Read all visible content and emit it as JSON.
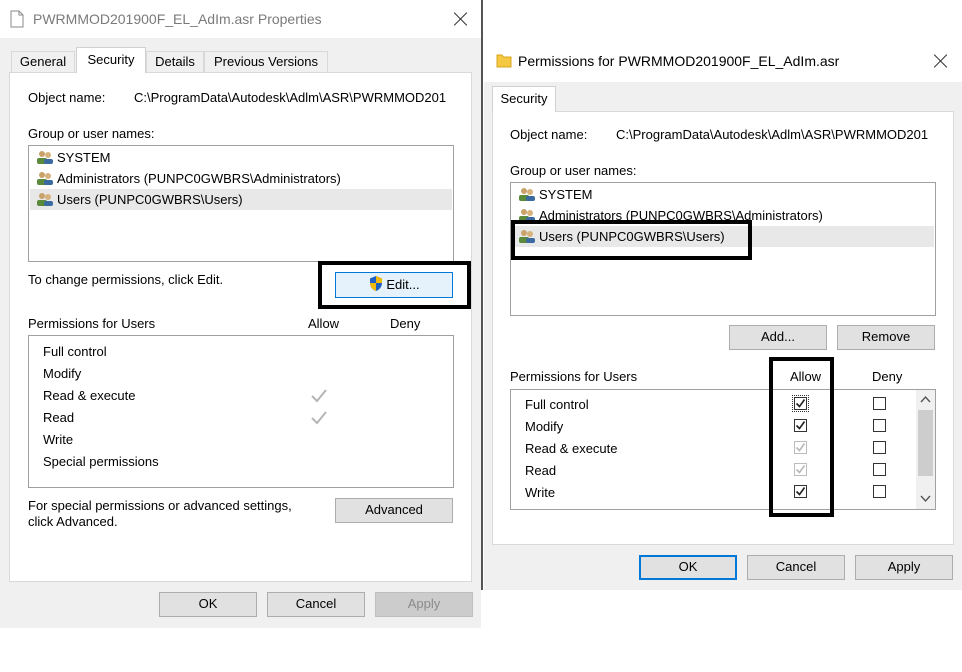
{
  "colors": {
    "highlight_box": "#000000",
    "accent": "#0078d7",
    "window_bg": "#f0f0f0"
  },
  "properties": {
    "title": "PWRMMOD201900F_EL_AdIm.asr Properties",
    "tabs": [
      "General",
      "Security",
      "Details",
      "Previous Versions"
    ],
    "active_tab": "Security",
    "object_name_label": "Object name:",
    "object_name_value": "C:\\ProgramData\\Autodesk\\Adlm\\ASR\\PWRMMOD201",
    "group_label": "Group or user names:",
    "users": [
      "SYSTEM",
      "Administrators (PUNPC0GWBRS\\Administrators)",
      "Users (PUNPC0GWBRS\\Users)"
    ],
    "change_text": "To change permissions, click Edit.",
    "edit_button": "Edit...",
    "permissions_for": "Permissions for Users",
    "allow_header": "Allow",
    "deny_header": "Deny",
    "permissions": [
      {
        "name": "Full control",
        "allow": false
      },
      {
        "name": "Modify",
        "allow": false
      },
      {
        "name": "Read & execute",
        "allow": true
      },
      {
        "name": "Read",
        "allow": true
      },
      {
        "name": "Write",
        "allow": false
      },
      {
        "name": "Special permissions",
        "allow": false
      }
    ],
    "special_text_1": "For special permissions or advanced settings,",
    "special_text_2": "click Advanced.",
    "advanced_button": "Advanced",
    "ok": "OK",
    "cancel": "Cancel",
    "apply": "Apply"
  },
  "perm_dialog": {
    "title": "Permissions for PWRMMOD201900F_EL_AdIm.asr",
    "tab": "Security",
    "object_name_label": "Object name:",
    "object_name_value": "C:\\ProgramData\\Autodesk\\Adlm\\ASR\\PWRMMOD201",
    "group_label": "Group or user names:",
    "users": [
      "SYSTEM",
      "Administrators (PUNPC0GWBRS\\Administrators)",
      "Users (PUNPC0GWBRS\\Users)"
    ],
    "add_button": "Add...",
    "remove_button": "Remove",
    "permissions_for": "Permissions for Users",
    "allow_header": "Allow",
    "deny_header": "Deny",
    "permissions": [
      {
        "name": "Full control",
        "allow": "checked",
        "deny": "unchecked"
      },
      {
        "name": "Modify",
        "allow": "checked",
        "deny": "unchecked"
      },
      {
        "name": "Read & execute",
        "allow": "checked-disabled",
        "deny": "unchecked"
      },
      {
        "name": "Read",
        "allow": "checked-disabled",
        "deny": "unchecked"
      },
      {
        "name": "Write",
        "allow": "checked",
        "deny": "unchecked"
      }
    ],
    "ok": "OK",
    "cancel": "Cancel",
    "apply": "Apply"
  }
}
